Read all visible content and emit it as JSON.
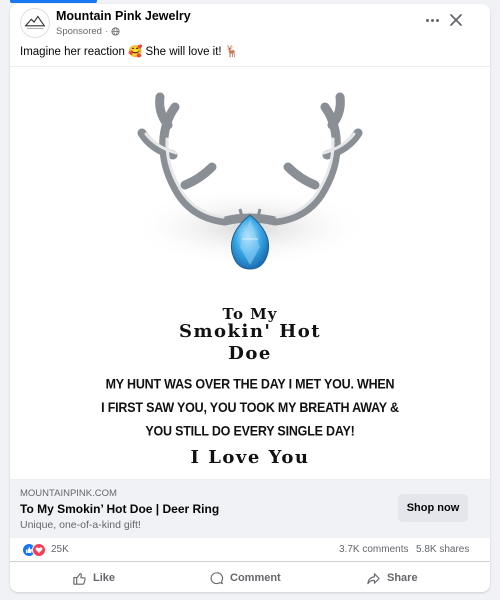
{
  "post": {
    "page_name": "Mountain Pink Jewelry",
    "sponsored": "Sponsored",
    "separator": "·",
    "caption": "Imagine her reaction 🥰 She will love it! 🦌"
  },
  "ad_image": {
    "line1": "To My",
    "line2": "Smokin' Hot",
    "line3": "Doe",
    "poem": [
      "MY HUNT WAS OVER THE DAY I MET YOU. WHEN",
      "I FIRST SAW YOU, YOU TOOK MY BREATH AWAY &",
      "YOU STILL DO EVERY SINGLE DAY!"
    ],
    "line5": "I Love You"
  },
  "link_preview": {
    "domain": "MOUNTAINPINK.COM",
    "headline": "To My Smokin’ Hot Doe | Deer Ring",
    "description": "Unique, one-of-a-kind gift!",
    "cta": "Shop now"
  },
  "engagement": {
    "reactions": "25K",
    "comments": "3.7K comments",
    "shares": "5.8K shares"
  },
  "actions": {
    "like": "Like",
    "comment": "Comment",
    "share": "Share"
  },
  "colors": {
    "brand_blue": "#1877f2",
    "love_red": "#f33e58",
    "gem_blue": "#3aa8e6",
    "secondary_text": "#65676b"
  }
}
